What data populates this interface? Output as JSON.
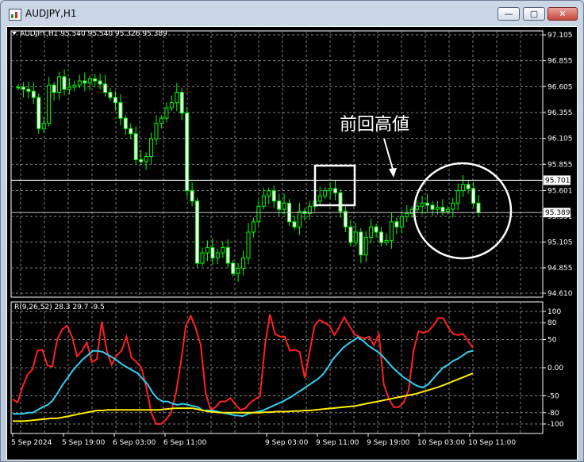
{
  "window": {
    "title": "AUDJPY,H1",
    "buttons": {
      "minimize": "—",
      "maximize": "▢",
      "close": "✕"
    }
  },
  "chart_data": [
    {
      "type": "candlestick",
      "header": "AUDJPY,H1  95.540 95.540 95.326 95.389",
      "ylim": [
        94.61,
        97.105
      ],
      "y_ticks": [
        "97.105",
        "96.855",
        "96.605",
        "96.355",
        "96.105",
        "95.855",
        "95.601",
        "95.351",
        "95.105",
        "94.855",
        "94.610"
      ],
      "x_ticks": [
        "5 Sep 2024",
        "5 Sep 19:00",
        "6 Sep 03:00",
        "6 Sep 11:00",
        "9 Sep 03:00",
        "9 Sep 11:00",
        "9 Sep 19:00",
        "10 Sep 03:00",
        "10 Sep 11:00"
      ],
      "price_labels": [
        "95.701",
        "95.389"
      ],
      "horizontal_line": 95.701,
      "annotation": "前回高値",
      "grid": true,
      "colors": {
        "bull": "#00ff00",
        "bear": "#ffffff",
        "background": "#000000",
        "grid": "#c0c0c0"
      }
    },
    {
      "type": "line",
      "header": "R(9,26,52) 28.3 29.7 -9.5",
      "ylim": [
        -100,
        100
      ],
      "y_ticks": [
        "100",
        "80",
        "50",
        "0.00",
        "-50",
        "-80",
        "-100"
      ],
      "series": [
        {
          "color": "#ff2020",
          "values": [
            -56,
            -62,
            -34,
            -12,
            -3,
            30,
            32,
            4,
            2,
            50,
            68,
            75,
            55,
            20,
            30,
            45,
            10,
            15,
            82,
            30,
            5,
            22,
            30,
            55,
            18,
            10,
            0,
            -35,
            -80,
            -100,
            -100,
            -92,
            -80,
            -45,
            10,
            75,
            92,
            70,
            40,
            -45,
            -75,
            -70,
            -60,
            -60,
            -54,
            -65,
            -75,
            -72,
            -62,
            -56,
            -50,
            42,
            95,
            60,
            55,
            55,
            30,
            32,
            28,
            -18,
            28,
            75,
            85,
            80,
            75,
            58,
            72,
            90,
            75,
            60,
            55,
            52,
            55,
            40,
            60,
            -30,
            -55,
            -70,
            -70,
            -62,
            -40,
            30,
            65,
            62,
            65,
            75,
            88,
            88,
            72,
            60,
            58,
            60,
            48,
            35
          ]
        },
        {
          "color": "#30d0f0",
          "values": [
            -82,
            -82,
            -82,
            -80,
            -80,
            -75,
            -70,
            -66,
            -58,
            -45,
            -30,
            -18,
            -5,
            5,
            15,
            22,
            30,
            30,
            28,
            23,
            18,
            12,
            5,
            0,
            -5,
            -10,
            -20,
            -30,
            -45,
            -55,
            -60,
            -60,
            -64,
            -66,
            -64,
            -66,
            -68,
            -70,
            -76,
            -76,
            -76,
            -78,
            -80,
            -82,
            -84,
            -85,
            -86,
            -82,
            -80,
            -78,
            -76,
            -72,
            -68,
            -64,
            -60,
            -55,
            -50,
            -44,
            -38,
            -32,
            -26,
            -20,
            -12,
            0,
            15,
            25,
            35,
            42,
            48,
            54,
            48,
            40,
            34,
            28,
            20,
            10,
            0,
            -8,
            -16,
            -22,
            -28,
            -33,
            -35,
            -30,
            -20,
            -10,
            0,
            5,
            12,
            16,
            22,
            28,
            30
          ]
        },
        {
          "color": "#ffee00",
          "values": [
            -95,
            -95,
            -95,
            -94,
            -93,
            -92,
            -91,
            -90,
            -90,
            -88,
            -86,
            -84,
            -82,
            -80,
            -78,
            -76,
            -76,
            -75,
            -75,
            -75,
            -75,
            -75,
            -75,
            -75,
            -75,
            -75,
            -75,
            -74,
            -73,
            -72,
            -72,
            -72,
            -72,
            -74,
            -76,
            -78,
            -79,
            -80,
            -80,
            -80,
            -80,
            -80,
            -80,
            -80,
            -80,
            -79,
            -79,
            -78,
            -78,
            -78,
            -77,
            -77,
            -76,
            -76,
            -75,
            -74,
            -73,
            -72,
            -71,
            -70,
            -69,
            -68,
            -66,
            -64,
            -62,
            -60,
            -58,
            -56,
            -54,
            -52,
            -50,
            -48,
            -46,
            -43,
            -40,
            -37,
            -34,
            -30,
            -26,
            -22,
            -18,
            -14,
            -10
          ]
        }
      ]
    }
  ],
  "annotations": {
    "label": "前回高値"
  }
}
